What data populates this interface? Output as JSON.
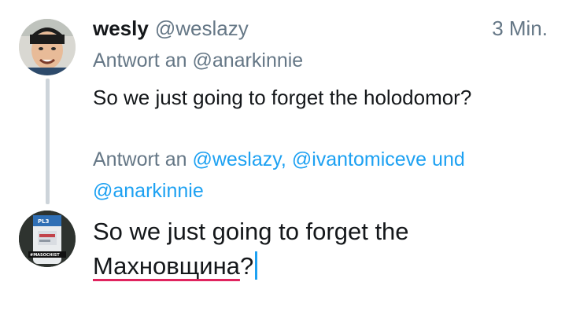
{
  "reply_tweet": {
    "display_name": "wesly",
    "handle": "@weslazy",
    "time": "3 Min.",
    "replying_to_label": "Antwort an",
    "replying_to_handle": "@anarkinnie",
    "text": "So we just going to forget the holodomor?"
  },
  "composer": {
    "replying_to_label": "Antwort an",
    "mention_1": "@weslazy,",
    "mention_2": "@ivantomiceve",
    "connector": "und",
    "mention_3": "@anarkinnie",
    "draft_text_prefix": "So we just going to forget the",
    "draft_text_misspelled": "Махновщина",
    "draft_text_suffix": "?",
    "avatar_badge": "#MASOCHIST",
    "avatar_bottle_label": "PL3"
  },
  "colors": {
    "text_primary": "#14171a",
    "text_secondary": "#657786",
    "accent": "#1da1f2",
    "spellcheck": "#e0245e",
    "thread_line": "#cdd4da"
  },
  "icons": {
    "avatar_top": "user-avatar-photo",
    "avatar_bottom": "user-avatar-bottle"
  }
}
